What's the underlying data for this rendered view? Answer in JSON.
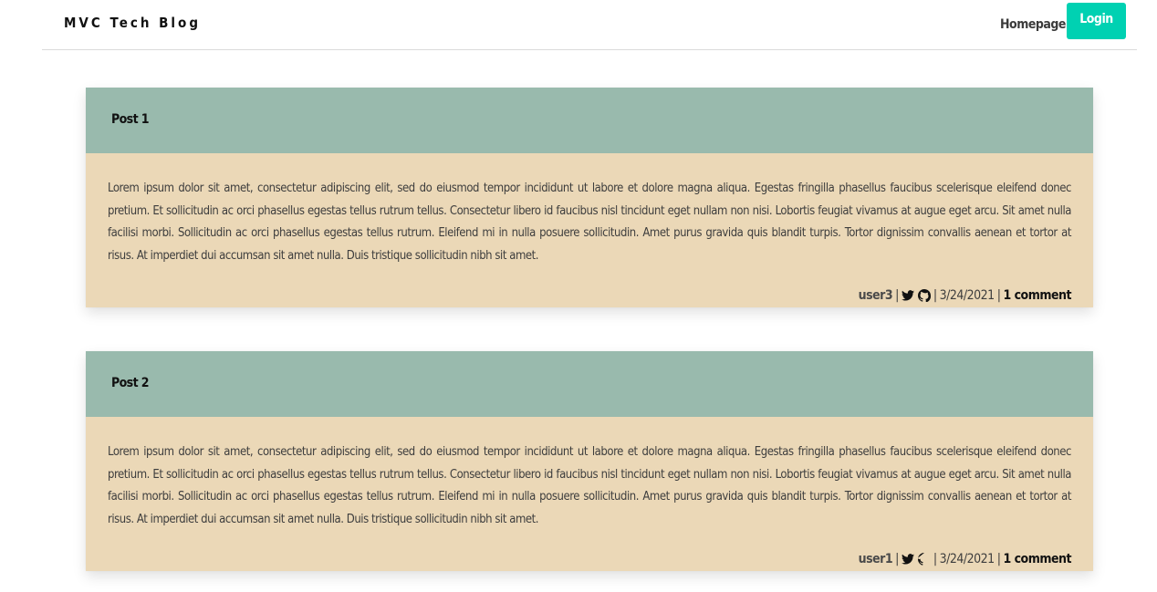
{
  "navbar": {
    "brand": "MVC Tech Blog",
    "homepage_label": "Homepage",
    "login_label": "Login"
  },
  "posts": [
    {
      "title": "Post 1",
      "content": "Lorem ipsum dolor sit amet, consectetur adipiscing elit, sed do eiusmod tempor incididunt ut labore et dolore magna aliqua. Egestas fringilla phasellus faucibus scelerisque eleifend donec pretium. Et sollicitudin ac orci phasellus egestas tellus rutrum tellus. Consectetur libero id faucibus nisl tincidunt eget nullam non nisi. Lobortis feugiat vivamus at augue eget arcu. Sit amet nulla facilisi morbi. Sollicitudin ac orci phasellus egestas tellus rutrum. Eleifend mi in nulla posuere sollicitudin. Amet purus gravida quis blandit turpis. Tortor dignissim convallis aenean et tortor at risus. At imperdiet dui accumsan sit amet nulla. Duis tristique sollicitudin nibh sit amet.",
      "author": "user3",
      "separator": "|",
      "date": "3/24/2021",
      "comments": "1 comment"
    },
    {
      "title": "Post 2",
      "content": "Lorem ipsum dolor sit amet, consectetur adipiscing elit, sed do eiusmod tempor incididunt ut labore et dolore magna aliqua. Egestas fringilla phasellus faucibus scelerisque eleifend donec pretium. Et sollicitudin ac orci phasellus egestas tellus rutrum tellus. Consectetur libero id faucibus nisl tincidunt eget nullam non nisi. Lobortis feugiat vivamus at augue eget arcu. Sit amet nulla facilisi morbi. Sollicitudin ac orci phasellus egestas tellus rutrum. Eleifend mi in nulla posuere sollicitudin. Amet purus gravida quis blandit turpis. Tortor dignissim convallis aenean et tortor at risus. At imperdiet dui accumsan sit amet nulla. Duis tristique sollicitudin nibh sit amet.",
      "author": "user1",
      "separator": "|",
      "date": "3/24/2021",
      "comments": "1 comment"
    }
  ],
  "icons": {
    "twitter": "twitter-icon",
    "github": "github-icon"
  },
  "colors": {
    "accent": "#00d1b2",
    "post_header": "#99baad",
    "post_body": "#ebd8b7"
  }
}
